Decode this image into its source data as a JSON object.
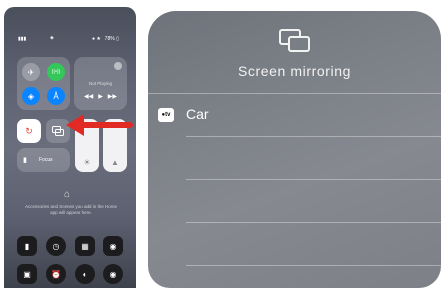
{
  "control_center": {
    "status": {
      "battery_text": "● ★   78% ▯"
    },
    "now_playing": {
      "label": "Not Playing",
      "prev": "◀◀",
      "play": "▶",
      "next": "▶▶"
    },
    "focus": {
      "label": "Focus"
    },
    "home_text": "Accessories and Scenes you add in the Home app will appear here."
  },
  "screen_mirroring": {
    "title": "Screen mirroring",
    "devices": [
      {
        "badge": "●tv",
        "name": "Car"
      }
    ]
  },
  "colors": {
    "arrow": "#e22a24",
    "lock_red": "#e5483b",
    "green": "#34c759",
    "blue": "#0a84ff"
  }
}
